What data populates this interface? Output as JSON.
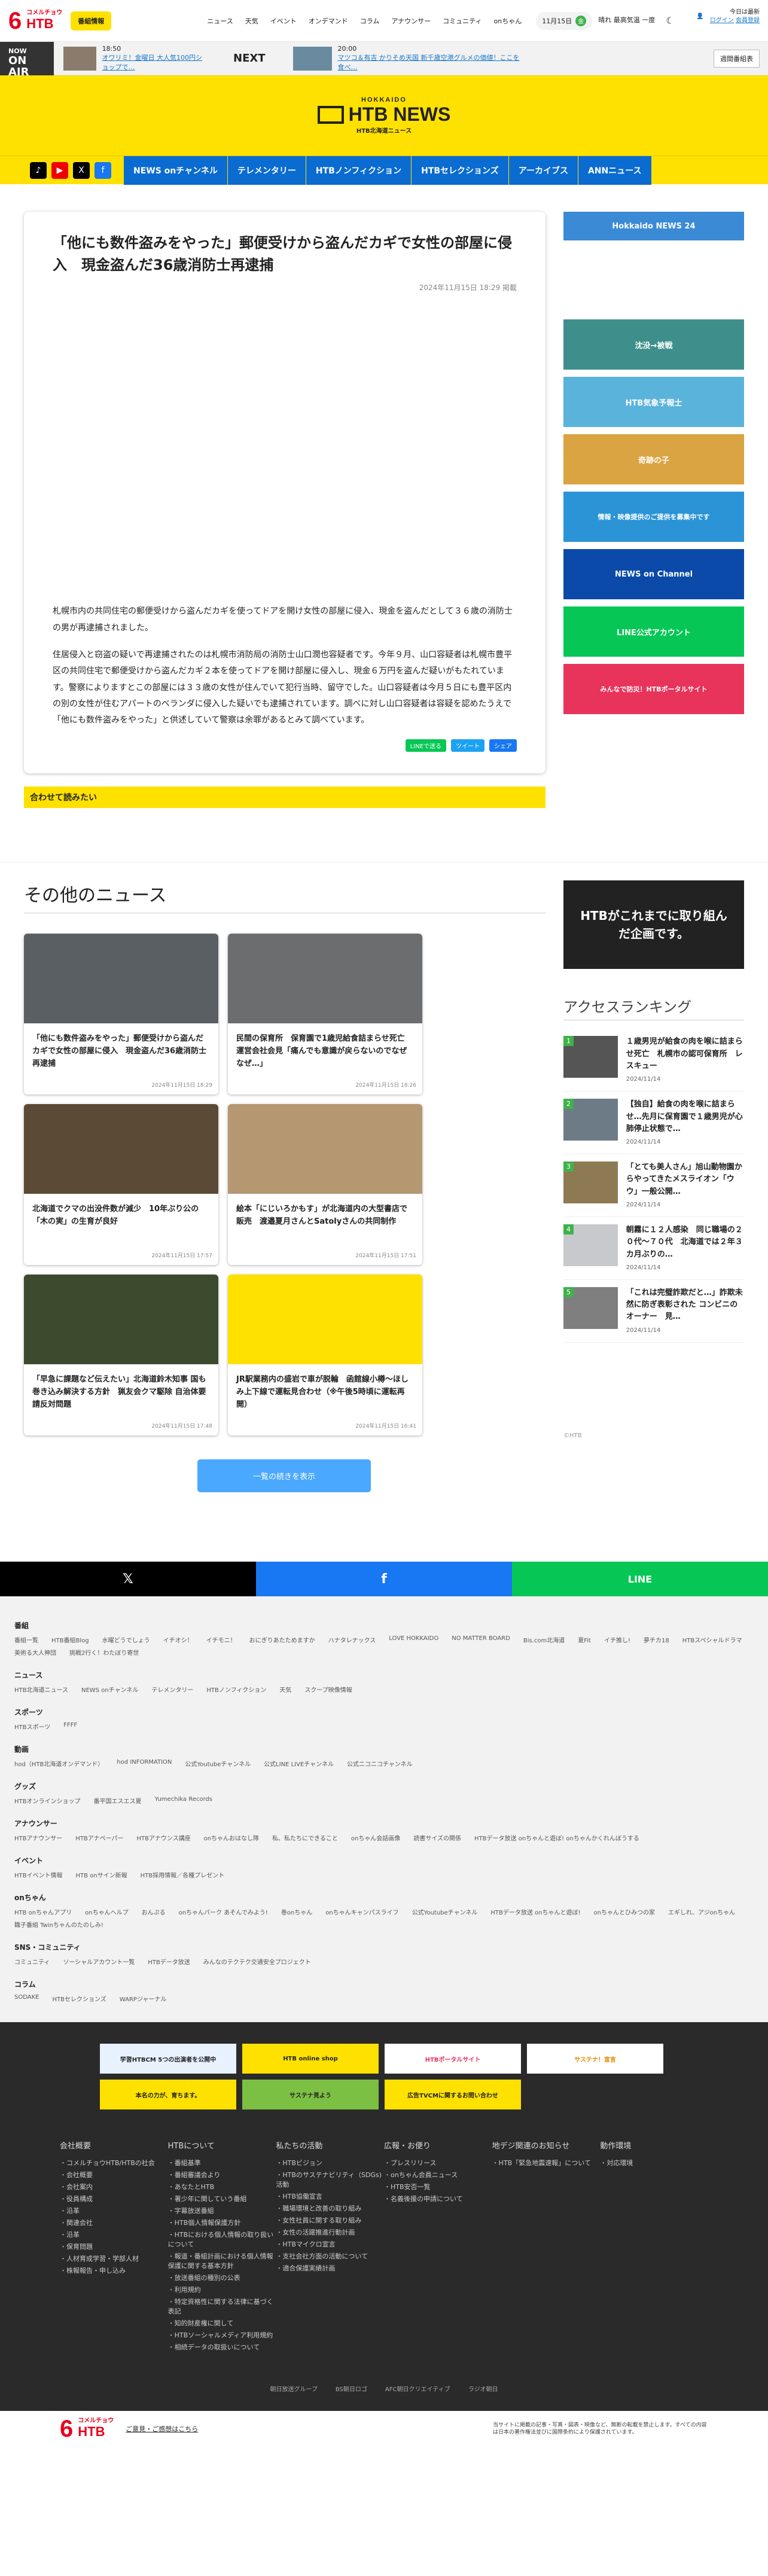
{
  "header": {
    "logo_small": "コメルチョウ",
    "logo_main": "HTB",
    "member_btn": "番組情報",
    "nav": [
      "ニュース",
      "天気",
      "イベント",
      "オンデマンド",
      "コラム",
      "アナウンサー",
      "コミュニティ",
      "onちゃん"
    ],
    "date": "11月15日",
    "date_badge": "金",
    "weather": "晴れ 最高気温 一度",
    "login_small": "今日は最新",
    "login_link": "ログイン",
    "login_link2": "会員登録"
  },
  "onair": {
    "now": "NOW",
    "on_air": "ON AIR",
    "now_time": "18:50",
    "now_title": "オワリミ！金曜日 大人気100円ショップで…",
    "next_label": "NEXT",
    "next_time": "20:00",
    "next_title": "マツコ＆有吉 かりそめ天国 新千歳空港グルメの価値！ここを食べ…",
    "cm_btn": "週間番組表"
  },
  "banner": {
    "hokkaido": "HOKKAIDO",
    "sub": "HTB北海道ニュース",
    "title": "HTB NEWS"
  },
  "nav": {
    "items": [
      "NEWS onチャンネル",
      "テレメンタリー",
      "HTBノンフィクション",
      "HTBセレクションズ",
      "アーカイブス",
      "ANNニュース"
    ]
  },
  "article": {
    "title": "「他にも数件盗みをやった」郵便受けから盗んだカギで女性の部屋に侵入　現金盗んだ36歳消防士再逮捕",
    "date": "2024年11月15日 18:29 掲載",
    "paras": [
      "札幌市内の共同住宅の郵便受けから盗んだカギを使ってドアを開け女性の部屋に侵入、現金を盗んだとして３６歳の消防士の男が再逮捕されました。",
      "住居侵入と窃盗の疑いで再逮捕されたのは札幌市消防局の消防士山口潤也容疑者です。今年９月、山口容疑者は札幌市豊平区の共同住宅で郵便受けから盗んだカギ２本を使ってドアを開け部屋に侵入し、現金６万円を盗んだ疑いがもたれています。警察によりますとこの部屋には３３歳の女性が住んでいて犯行当時、留守でした。山口容疑者は今月５日にも豊平区内の別の女性が住むアパートのベランダに侵入した疑いでも逮捕されています。調べに対し山口容疑者は容疑を認めたうえで「他にも数件盗みをやった」と供述していて警察は余罪があるとみて調べています。"
    ],
    "share": [
      "LINEで送る",
      "ツイート",
      "シェア"
    ],
    "related": "合わせて読みたい"
  },
  "side": {
    "banners": [
      "Hokkaido NEWS 24",
      "沈没→被戦",
      "HTB気象予報士",
      "奇跡の子",
      "情報・映像提供のご提供を募集中です",
      "NEWS on Channel",
      "LINE公式アカウント",
      "みんなで防災！HTBポータルサイト"
    ]
  },
  "others": {
    "title": "その他のニュース",
    "cards": [
      {
        "t": "「他にも数件盗みをやった」郵便受けから盗んだカギで女性の部屋に侵入　現金盗んだ36歳消防士再逮捕",
        "d": "2024年11月15日 18:29"
      },
      {
        "t": "民間の保育所　保育園で1歳児給食詰まらせ死亡　運営会社会見「痛んでも意識が戻らないのでなぜなぜ…」",
        "d": "2024年11月15日 18:26"
      },
      {
        "t": "北海道でクマの出没件数が減少　10年ぶり公の「木の実」の生育が良好",
        "d": "2024年11月15日 17:57"
      },
      {
        "t": "絵本「にじいろかもす」が北海道内の大型書店で販売　渡邉夏月さんとSatolyさんの共同制作",
        "d": "2024年11月15日 17:51"
      },
      {
        "t": "「早急に課題など伝えたい」北海道鈴木知事 国も巻き込み解決する方針　猟友会クマ駆除 自治体要請反対問題",
        "d": "2024年11月15日 17:48"
      },
      {
        "t": "JR駅業務内の盛岩で車が脱輪　函館線小樽～ほしみ上下線で運転見合わせ（※午後5時頃に運転再開）",
        "d": "2024年11月15日 16:41"
      }
    ],
    "more": "一覧の続きを表示",
    "promo": "HTBがこれまでに取り組んだ企画です。",
    "rank_title": "アクセスランキング",
    "ranking": [
      {
        "n": "1",
        "t": "１歳男児が給食の肉を喉に詰まらせ死亡　札幌市の認可保育所　レスキュー",
        "d": "2024/11/14"
      },
      {
        "t": "【独自】給食の肉を喉に詰まらせ…先月に保育園で１歳男児が心肺停止状態で…",
        "n": "2",
        "d": "2024/11/14"
      },
      {
        "n": "3",
        "t": "「とても美人さん」旭山動物園からやってきたメスライオン「ウウ」一般公開…",
        "d": "2024/11/14"
      },
      {
        "n": "4",
        "t": "朝霧に１２人感染　同じ職場の２０代～７０代　北海道では２年３カ月ぶりの…",
        "d": "2024/11/14"
      },
      {
        "n": "5",
        "t": "「これは完璧詐欺だと…」詐欺未然に防ぎ表彰された コンビニのオーナー　見…",
        "d": "2024/11/14"
      }
    ],
    "copyright": "©HTB"
  },
  "sharebar": {
    "x": "𝕏",
    "fb": "f",
    "line": "LINE"
  },
  "sitemap": [
    {
      "h": "番組",
      "l": [
        "番組一覧",
        "HTB番組Blog",
        "水曜どうでしょう",
        "イチオシ！",
        "イチモニ！",
        "おにぎりあたためますか",
        "ハナタレナックス",
        "LOVE HOKKAIDO",
        "NO MATTER BOARD",
        "Bis.com北海道",
        "夏Fit",
        "イチ推し!",
        "夢チカ18",
        "HTBスペシャルドラマ",
        "美術る大人神団",
        "挑戦2行く！わたぼり寄世"
      ]
    },
    {
      "h": "ニュース",
      "l": [
        "HTB北海道ニュース",
        "NEWS onチャンネル",
        "テレメンタリー",
        "HTBノンフィクション",
        "天気",
        "スクープ映像情報"
      ]
    },
    {
      "h": "スポーツ",
      "l": [
        "HTBスポーツ",
        "FFFF"
      ]
    },
    {
      "h": "動画",
      "l": [
        "hod（HTB北海道オンデマンド）",
        "hod INFORMATION",
        "公式Youtubeチャンネル",
        "公式LINE LIVEチャンネル",
        "公式ニコニコチャンネル"
      ]
    },
    {
      "h": "グッズ",
      "l": [
        "HTBオンラインショップ",
        "番平国エスエス夏",
        "Yumechika Records"
      ]
    },
    {
      "h": "アナウンサー",
      "l": [
        "HTBアナウンサー",
        "HTBアナペーパー",
        "HTBアナウンス講座",
        "onちゃんおはなし隊",
        "私、私たちにできること",
        "onちゃん会話画像",
        "読書サイズの関係",
        "HTBデータ放送 onちゃんと遊ぼ! onちゃんかくれんぼうする"
      ]
    },
    {
      "h": "イベント",
      "l": [
        "HTBイベント情報",
        "HTB onサイン新報",
        "HTB採用情報／各種プレゼント"
      ]
    },
    {
      "h": "onちゃん",
      "l": [
        "HTB onちゃんアプリ",
        "onちゃんヘルプ",
        "おんぷる",
        "onちゃんパーク あそんでみよう!",
        "巻onちゃん",
        "onちゃんキャンパスライフ",
        "公式Youtubeチャンネル",
        "HTBデータ放送 onちゃんと遊ぼ!",
        "onちゃんとひみつの家",
        "エギしれ、アジonちゃん",
        "職子番組 Twinちゃんのたのしみ!"
      ]
    },
    {
      "h": "SNS・コミュニティ",
      "l": [
        "コミュニティ",
        "ソーシャルアカウント一覧",
        "HTBデータ放送",
        "みんなのテクテク交通安全プロジェクト"
      ]
    },
    {
      "h": "コラム",
      "l": [
        "SODAKE",
        "HTBセレクションズ",
        "WARPジャーナル"
      ]
    }
  ],
  "footer": {
    "banners": [
      "学習HTBCM 5つの出演者を公開中",
      "HTB online shop",
      "HTBポータルサイト",
      "サステナ！宣言",
      "本名の力が、育ちます。",
      "サステナ見よう",
      "広告TVCMに関するお問い合わせ",
      ""
    ],
    "cols": [
      {
        "h": "会社概要",
        "l": [
          "コメルチョウHTB/HTBの社会",
          "会社概要",
          "会社案内",
          "役員構成",
          "沿革",
          "関連会社",
          "沿革",
          "保育問題",
          "人材育成学習・学部人材",
          "株報報告・申し込み"
        ]
      },
      {
        "h": "HTBについて",
        "l": [
          "番組基準",
          "番組審議会より",
          "あなたとHTB",
          "著少年に関していう番組",
          "字幕放送番組",
          "HTB個人情報保護方針",
          "HTBにおける個人情報の取り扱いについて",
          "報道・番組計画における個人情報保護に関する基本方針",
          "放送番組の種別の公表",
          "利用規約",
          "特定資格性に関する法律に基づく表記",
          "知的財産権に関して",
          "HTBソーシャルメディア利用規約",
          "相続データの取扱いについて"
        ]
      },
      {
        "h": "私たちの活動",
        "l": [
          "HTBビジョン",
          "HTBのサステナビリティ（SDGs)活動",
          "HTB協働宣言",
          "職場環境と改善の取り組み",
          "女性社員に関する取り組み",
          "女性の活躍推進行動計画",
          "HTBマイクロ宣言",
          "支社会社方面の活動について",
          "適合保護実績計画"
        ]
      },
      {
        "h": "広報・お便り",
        "l": [
          "プレスリリース",
          "onちゃん会員ニュース",
          "HTB安否一覧",
          "名義後援の申請について"
        ]
      },
      {
        "h": "地デジ関連のお知らせ",
        "l": [
          "HTB「緊急地震速報」について"
        ]
      },
      {
        "h": "動作環境",
        "l": [
          "対応環境"
        ]
      }
    ],
    "bottom": [
      "朝日放送グループ",
      "BS朝日ロゴ",
      "AFC朝日クリエイティブ",
      "ラジオ朝日"
    ],
    "last_link": "ご意見・ご感想はこちら",
    "copyright": "当サイトに掲載の記事・写真・図表・映像など、無断の転載を禁止します。すべての内容は日本の著作権法並びに国際条約により保護されています。"
  }
}
